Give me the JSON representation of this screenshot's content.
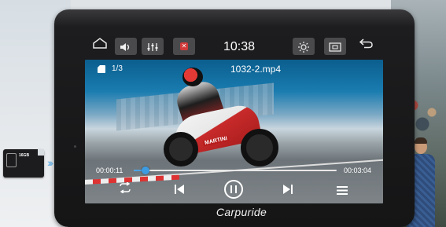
{
  "toolbar": {
    "home_icon": "home-icon",
    "volume_icon": "volume-icon",
    "equalizer_icon": "equalizer-icon",
    "close_icon": "close-icon",
    "time": "10:38",
    "brightness_icon": "brightness-icon",
    "screen_icon": "screen-mirror-icon",
    "back_icon": "back-icon"
  },
  "player": {
    "page_count": "1/3",
    "file_name": "1032-2.mp4",
    "elapsed": "00:00:11",
    "duration": "00:03:04",
    "progress_fraction": 0.06,
    "bike_label": "MARTINI"
  },
  "controls": {
    "repeat_icon": "repeat-icon",
    "prev_icon": "skip-previous-icon",
    "pause_icon": "pause-icon",
    "next_icon": "skip-next-icon",
    "playlist_icon": "playlist-icon"
  },
  "brand": "Carpuride",
  "sd_card": {
    "text": "16GB"
  },
  "colors": {
    "accent": "#3d9be2",
    "close": "#d23a3a"
  }
}
